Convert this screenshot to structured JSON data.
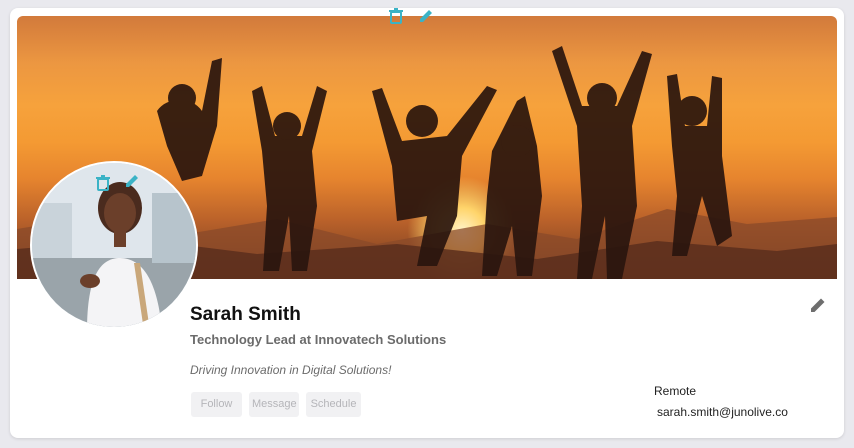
{
  "cover": {
    "delete_icon": "trash-icon",
    "edit_icon": "pencil-icon",
    "accent_color": "#3bb3c6"
  },
  "avatar": {
    "delete_icon": "trash-icon",
    "edit_icon": "pencil-icon"
  },
  "profile": {
    "name": "Sarah Smith",
    "title": "Technology Lead at Innovatech Solutions",
    "tagline": "Driving Innovation in Digital Solutions!",
    "location": "Remote",
    "email": "sarah.smith@junolive.co",
    "edit_icon": "pencil-icon"
  },
  "actions": {
    "follow_label": "Follow",
    "message_label": "Message",
    "schedule_label": "Schedule"
  }
}
